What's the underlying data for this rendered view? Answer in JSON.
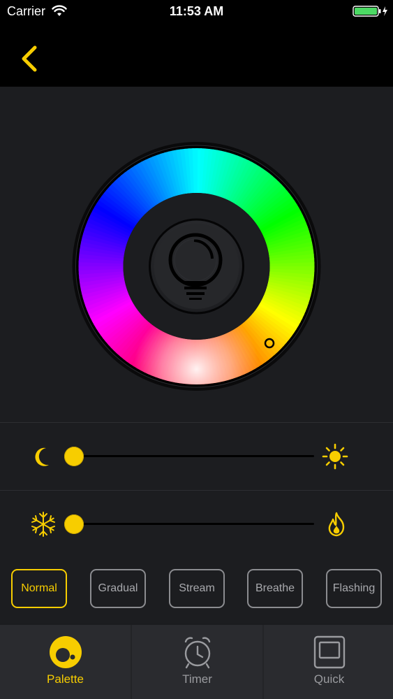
{
  "status_bar": {
    "carrier": "Carrier",
    "time": "11:53 AM"
  },
  "nav": {
    "back_icon": "chevron-left-icon"
  },
  "colors": {
    "accent": "#f7cd00",
    "background": "#1c1d20",
    "inactive": "#9a9b9f"
  },
  "sliders": {
    "brightness": {
      "min_icon": "moon-icon",
      "max_icon": "sun-icon",
      "value": 0.0
    },
    "temperature": {
      "min_icon": "snowflake-icon",
      "max_icon": "flame-icon",
      "value": 0.0
    }
  },
  "modes": [
    {
      "label": "Normal",
      "active": true
    },
    {
      "label": "Gradual",
      "active": false
    },
    {
      "label": "Stream",
      "active": false
    },
    {
      "label": "Breathe",
      "active": false
    },
    {
      "label": "Flashing",
      "active": false
    }
  ],
  "tabs": [
    {
      "label": "Palette",
      "icon": "palette-icon",
      "active": true
    },
    {
      "label": "Timer",
      "icon": "alarm-clock-icon",
      "active": false
    },
    {
      "label": "Quick",
      "icon": "quick-icon",
      "active": false
    }
  ]
}
